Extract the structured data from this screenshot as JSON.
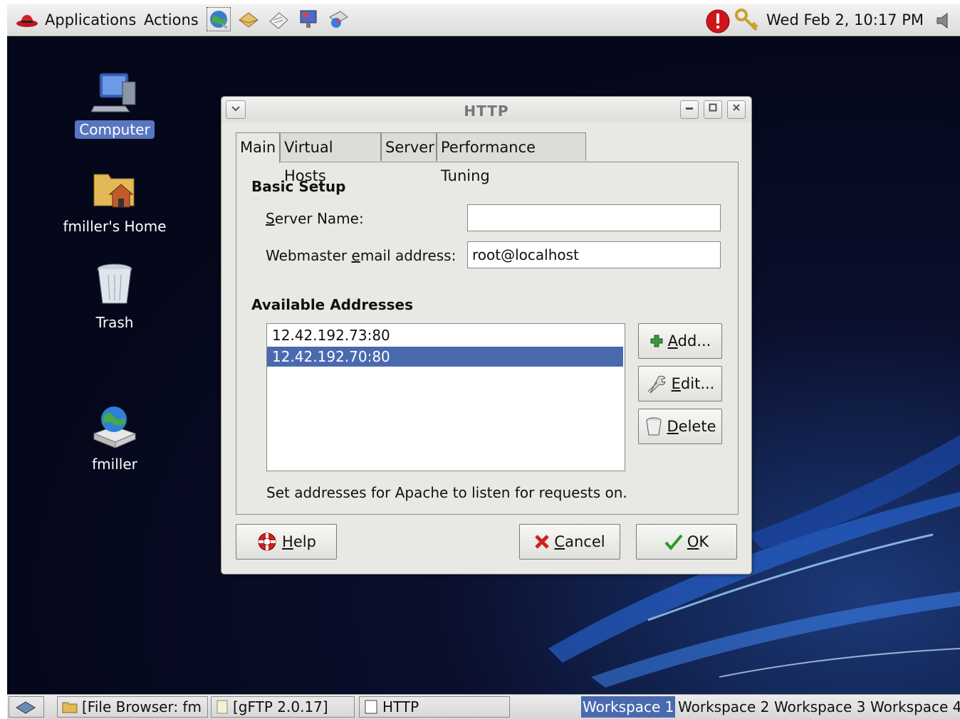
{
  "top_panel": {
    "menu_applications": "Applications",
    "menu_actions": "Actions",
    "clock": "Wed Feb  2, 10:17 PM"
  },
  "desktop_icons": [
    {
      "label": "Computer",
      "icon": "computer-icon"
    },
    {
      "label": "fmiller's Home",
      "icon": "home-folder-icon"
    },
    {
      "label": "Trash",
      "icon": "trash-icon"
    },
    {
      "label": "fmiller",
      "icon": "network-server-icon"
    }
  ],
  "dialog": {
    "title": "HTTP",
    "tabs": [
      "Main",
      "Virtual Hosts",
      "Server",
      "Performance Tuning"
    ],
    "basic_setup_heading": "Basic Setup",
    "server_name_label_u": "S",
    "server_name_label_rest": "erver Name:",
    "server_name_value": "",
    "webmaster_label_pre": "Webmaster ",
    "webmaster_label_u": "e",
    "webmaster_label_rest": "mail address:",
    "webmaster_value": "root@localhost",
    "available_heading": "Available Addresses",
    "addresses": [
      "12.42.192.73:80",
      "12.42.192.70:80"
    ],
    "selected_address": "12.42.192.70:80",
    "add_u": "A",
    "add_rest": "dd...",
    "edit_u": "E",
    "edit_rest": "dit...",
    "delete_u": "D",
    "delete_rest": "elete",
    "hint": "Set addresses for Apache to listen for requests on.",
    "help_u": "H",
    "help_rest": "elp",
    "cancel_u": "C",
    "cancel_rest": "ancel",
    "ok_u": "O",
    "ok_rest": "K"
  },
  "taskbar": {
    "tasks": [
      "[File Browser: fm",
      "[gFTP 2.0.17]",
      "HTTP"
    ],
    "workspaces": [
      "Workspace 1",
      "Workspace 2",
      "Workspace 3",
      "Workspace 4"
    ],
    "active_workspace": "Workspace 1"
  },
  "colors": {
    "selection": "#4a6aaf",
    "desktop_bg": "#05081a",
    "dialog_bg": "#e8e8e5"
  }
}
